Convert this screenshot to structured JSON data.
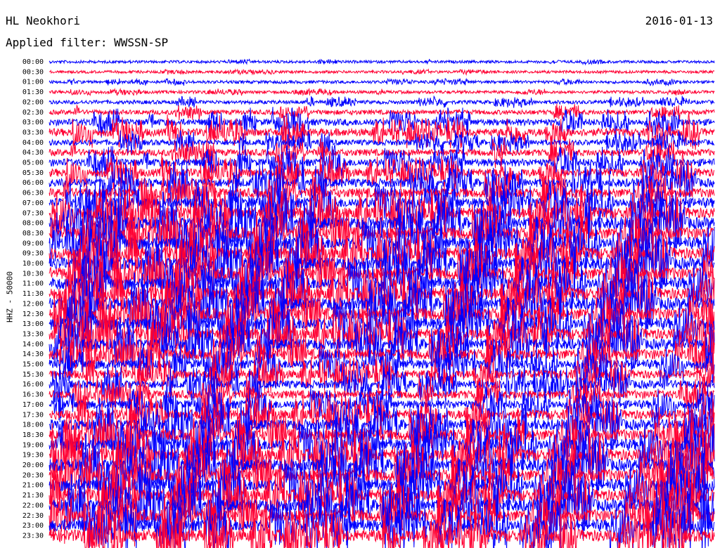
{
  "header": {
    "station": "HL Neokhori",
    "date": "2016-01-13",
    "filter": "Applied filter: WWSSN-SP"
  },
  "colors": {
    "trace_a": "#0000ff",
    "trace_b": "#ff0033"
  },
  "chart_data": {
    "type": "line",
    "title": "",
    "xlabel": "",
    "ylabel": "HHZ - 50000",
    "y_ticks": [
      "00:00",
      "00:30",
      "01:00",
      "01:30",
      "02:00",
      "02:30",
      "03:00",
      "03:30",
      "04:00",
      "04:30",
      "05:00",
      "05:30",
      "06:00",
      "06:30",
      "07:00",
      "07:30",
      "08:00",
      "08:30",
      "09:00",
      "09:30",
      "10:00",
      "10:30",
      "11:00",
      "11:30",
      "12:00",
      "12:30",
      "13:00",
      "13:30",
      "14:00",
      "14:30",
      "15:00",
      "15:30",
      "16:00",
      "16:30",
      "17:00",
      "17:30",
      "18:00",
      "18:30",
      "19:00",
      "19:30",
      "20:00",
      "20:30",
      "21:00",
      "21:30",
      "22:00",
      "22:30",
      "23:00",
      "23:30"
    ],
    "activity_level": [
      0.05,
      0.05,
      0.08,
      0.08,
      0.15,
      0.25,
      0.45,
      0.55,
      0.35,
      0.45,
      0.55,
      0.6,
      0.65,
      0.7,
      0.8,
      0.9,
      1.0,
      1.0,
      1.0,
      1.0,
      1.0,
      1.0,
      1.0,
      1.0,
      1.0,
      1.0,
      1.0,
      0.9,
      0.85,
      0.8,
      0.7,
      0.65,
      0.6,
      0.6,
      0.65,
      0.75,
      0.85,
      0.9,
      0.95,
      1.0,
      1.0,
      1.0,
      1.0,
      1.0,
      1.0,
      1.0,
      1.0,
      1.0
    ],
    "grid": false,
    "legend": "none"
  }
}
